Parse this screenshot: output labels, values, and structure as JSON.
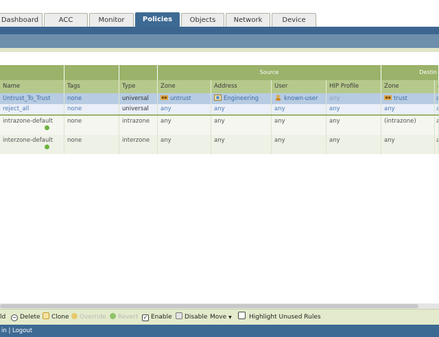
{
  "tabs": [
    {
      "label": "Dashboard"
    },
    {
      "label": "ACC"
    },
    {
      "label": "Monitor"
    },
    {
      "label": "Policies"
    },
    {
      "label": "Objects"
    },
    {
      "label": "Network"
    },
    {
      "label": "Device"
    }
  ],
  "table": {
    "group_headers": {
      "source": "Source",
      "destination": "Destin"
    },
    "columns": [
      "Name",
      "Tags",
      "Type",
      "Zone",
      "Address",
      "User",
      "HIP Profile",
      "Zone",
      "a"
    ],
    "rows": [
      {
        "name": "Untrust_To_Trust",
        "tags": "none",
        "type": "universal",
        "src_zone": "untrust",
        "src_address": "Engineering",
        "src_user": "known-user",
        "hip": "any",
        "dst_zone": "trust",
        "dst_cut": "a"
      },
      {
        "name": "reject_all",
        "tags": "none",
        "type": "universal",
        "src_zone": "any",
        "src_address": "any",
        "src_user": "any",
        "hip": "any",
        "dst_zone": "any",
        "dst_cut": "a"
      },
      {
        "name": "intrazone-default",
        "tags": "none",
        "type": "intrazone",
        "src_zone": "any",
        "src_address": "any",
        "src_user": "any",
        "hip": "any",
        "dst_zone": "(intrazone)",
        "dst_cut": "a"
      },
      {
        "name": "interzone-default",
        "tags": "none",
        "type": "interzone",
        "src_zone": "any",
        "src_address": "any",
        "src_user": "any",
        "hip": "any",
        "dst_zone": "any",
        "dst_cut": "a"
      }
    ]
  },
  "toolbar": {
    "add": "ld",
    "delete": "Delete",
    "clone": "Clone",
    "override": "Override",
    "revert": "Revert",
    "enable": "Enable",
    "disable": "Disable",
    "move": "Move",
    "highlight": "Highlight Unused Rules"
  },
  "footer": {
    "text": "in | Logout"
  },
  "colors": {
    "accent": "#3d6a93",
    "header_green": "#9ab26a",
    "selected_row": "#b7cbe2"
  }
}
